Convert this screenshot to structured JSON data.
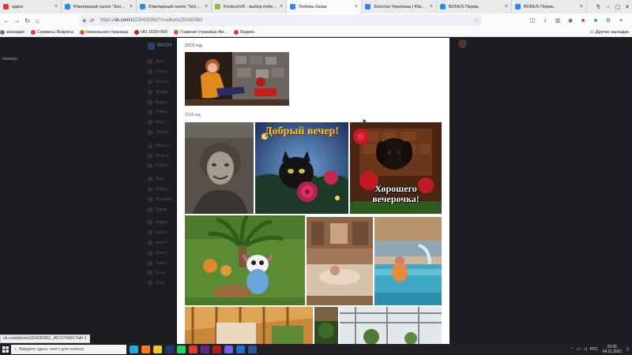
{
  "browser": {
    "tabs": [
      {
        "label": "ндекс",
        "color": "#e03a2f"
      },
      {
        "label": "Ювелирный салон \"Золотая Ч...",
        "color": "#2787f5"
      },
      {
        "label": "Ювелирный салон \"Золотая Ч...",
        "color": "#2787f5"
      },
      {
        "label": "KonkursVK - выбор победит...",
        "color": "#8dbb3b"
      },
      {
        "label": "Любовь Казак",
        "color": "#2787f5",
        "active": true
      },
      {
        "label": "Золотая Черепаха | Ювелирн...",
        "color": "#2787f5"
      },
      {
        "label": "BONUS Пермь",
        "color": "#2787f5"
      },
      {
        "label": "BONUS Пермь",
        "color": "#2787f5"
      }
    ],
    "new_tab": "+",
    "url_prefix": "https://",
    "url_host": "vk.com",
    "url_path": "/id220430362?z=album220430362",
    "bookmarks": [
      {
        "label": "закладки",
        "color": "#777777"
      },
      {
        "label": "Сервисы Яндекса",
        "color": "#e03a2f"
      },
      {
        "label": "Начальная страница",
        "color": "#e05a2f"
      },
      {
        "label": "HD 1600×900",
        "color": "#c02020"
      },
      {
        "label": "Главная страница Фи...",
        "color": "#e05a2f"
      },
      {
        "label": "Яндекс",
        "color": "#e03a2f"
      }
    ],
    "bookmarks_right": "Другие закладки"
  },
  "page": {
    "left_text": "Неверн",
    "vk_name": "ВКОН",
    "menu": [
      "Друг",
      "Стран",
      "Фотогр",
      "Музык",
      "Видео",
      "Клипы",
      "Игры",
      "Объяв",
      "Мини-п",
      "VK Pay",
      "Работа",
      "Закл",
      "Файлы",
      "Реклама",
      "Управ",
      "Новые",
      "Чертё",
      "Чертё",
      "Золот",
      "Золот",
      "Шоко",
      "Стра"
    ]
  },
  "album": {
    "sections": [
      {
        "year": "2019 год"
      },
      {
        "year": "2018 год"
      }
    ],
    "photos": [
      {
        "subject": "woman in orange sitting by stone fireplace",
        "caption": ""
      },
      {
        "subject": "sepia portrait of smiling woman",
        "caption": ""
      },
      {
        "subject": "black cat with rose greeting card",
        "caption": "Добрый вечер!"
      },
      {
        "subject": "black puppy on chocolate bar with roses",
        "caption": "Хорошего вечерочка!"
      },
      {
        "subject": "garden figurine with palm tree and pumpkins",
        "caption": ""
      },
      {
        "subject": "woman resting in spa lounge",
        "caption": ""
      },
      {
        "subject": "woman in pool with fountain",
        "caption": ""
      },
      {
        "subject": "sauna interior with wooden roof",
        "caption": ""
      },
      {
        "subject": "winter garden greenhouse",
        "caption": ""
      }
    ]
  },
  "status_url": "vk.com/photo220430362_457370681?all=1",
  "taskbar": {
    "search_placeholder": "Введите здесь текст для поиска",
    "lang": "РУС",
    "time": "22:01",
    "date": "04.11.2021"
  }
}
